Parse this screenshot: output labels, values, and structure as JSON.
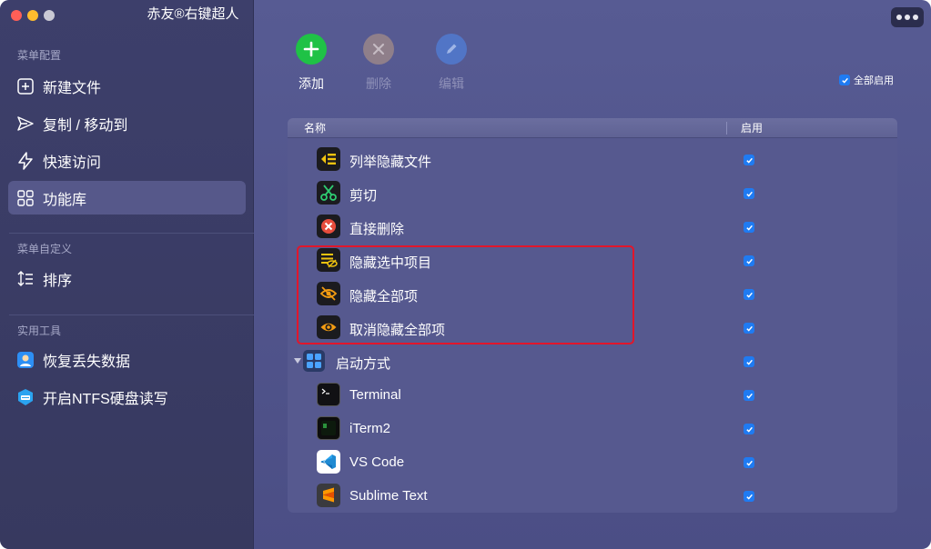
{
  "window": {
    "title": "赤友®右键超人"
  },
  "sidebar": {
    "sections": [
      {
        "label": "菜单配置",
        "items": [
          {
            "label": "新建文件",
            "icon": "plus-square-icon"
          },
          {
            "label": "复制 / 移动到",
            "icon": "send-icon"
          },
          {
            "label": "快速访问",
            "icon": "lightning-icon"
          },
          {
            "label": "功能库",
            "icon": "grid-icon",
            "active": true
          }
        ]
      },
      {
        "label": "菜单自定义",
        "items": [
          {
            "label": "排序",
            "icon": "sort-icon"
          }
        ]
      },
      {
        "label": "实用工具",
        "items": [
          {
            "label": "恢复丢失数据",
            "icon": "recover-app-icon"
          },
          {
            "label": "开启NTFS硬盘读写",
            "icon": "ntfs-app-icon"
          }
        ]
      }
    ]
  },
  "toolbar": {
    "add_label": "添加",
    "delete_label": "删除",
    "edit_label": "编辑",
    "enable_all_label": "全部启用",
    "enable_all_checked": true
  },
  "table": {
    "headers": {
      "name": "名称",
      "enabled": "启用"
    },
    "rows": [
      {
        "label": "列举隐藏文件",
        "icon": "list-hidden-icon",
        "enabled": true
      },
      {
        "label": "剪切",
        "icon": "scissors-icon",
        "enabled": true
      },
      {
        "label": "直接删除",
        "icon": "delete-x-icon",
        "enabled": true
      },
      {
        "label": "隐藏选中项目",
        "icon": "hide-selected-icon",
        "enabled": true
      },
      {
        "label": "隐藏全部项",
        "icon": "eye-slash-icon",
        "enabled": true
      },
      {
        "label": "取消隐藏全部项",
        "icon": "eye-icon",
        "enabled": true
      },
      {
        "label": "启动方式",
        "icon": "launch-grid-icon",
        "enabled": true,
        "group": true
      },
      {
        "label": "Terminal",
        "icon": "terminal-icon",
        "enabled": true
      },
      {
        "label": "iTerm2",
        "icon": "iterm2-icon",
        "enabled": true
      },
      {
        "label": "VS Code",
        "icon": "vscode-icon",
        "enabled": true
      },
      {
        "label": "Sublime Text",
        "icon": "sublime-text-icon",
        "enabled": true
      }
    ]
  },
  "colors": {
    "accent": "#1f7bf2",
    "add": "#22c24a",
    "highlight_border": "#e2162b"
  }
}
